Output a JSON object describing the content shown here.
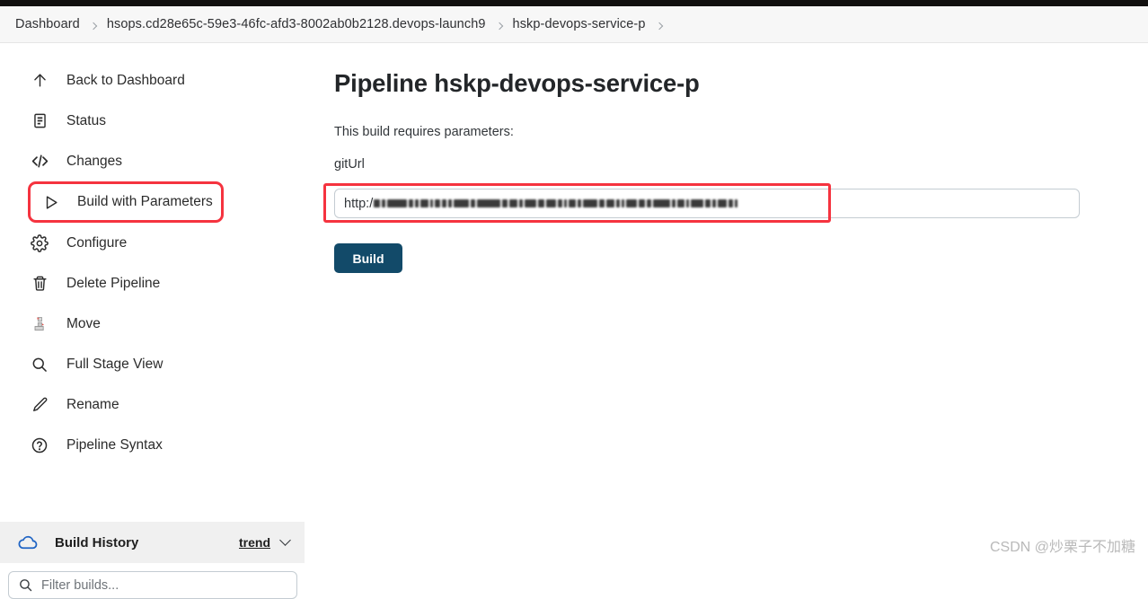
{
  "breadcrumb": {
    "items": [
      {
        "label": "Dashboard"
      },
      {
        "label": "hsops.cd28e65c-59e3-46fc-afd3-8002ab0b2128.devops-launch9"
      },
      {
        "label": "hskp-devops-service-p"
      }
    ]
  },
  "sidebar": {
    "items": [
      {
        "label": "Back to Dashboard",
        "icon": "arrow-up-icon",
        "highlighted": false
      },
      {
        "label": "Status",
        "icon": "document-icon",
        "highlighted": false
      },
      {
        "label": "Changes",
        "icon": "code-brackets-icon",
        "highlighted": false
      },
      {
        "label": "Build with Parameters",
        "icon": "play-triangle-icon",
        "highlighted": true
      },
      {
        "label": "Configure",
        "icon": "gear-icon",
        "highlighted": false
      },
      {
        "label": "Delete Pipeline",
        "icon": "trash-icon",
        "highlighted": false
      },
      {
        "label": "Move",
        "icon": "move-icon",
        "highlighted": false
      },
      {
        "label": "Full Stage View",
        "icon": "magnifier-icon",
        "highlighted": false
      },
      {
        "label": "Rename",
        "icon": "pencil-icon",
        "highlighted": false
      },
      {
        "label": "Pipeline Syntax",
        "icon": "question-circle-icon",
        "highlighted": false
      }
    ],
    "build_history": {
      "title": "Build History",
      "icon": "cloud-icon",
      "trend_label": "trend",
      "filter_placeholder": "Filter builds..."
    }
  },
  "main": {
    "title": "Pipeline hskp-devops-service-p",
    "requires_text": "This build requires parameters:",
    "parameter": {
      "name": "gitUrl",
      "value": "http:/",
      "value_redacted": true
    },
    "build_button": "Build"
  },
  "annotations": {
    "color": "#f5333f",
    "targets": [
      "Build with Parameters",
      "gitUrl input"
    ]
  },
  "watermark": "CSDN @炒栗子不加糖"
}
